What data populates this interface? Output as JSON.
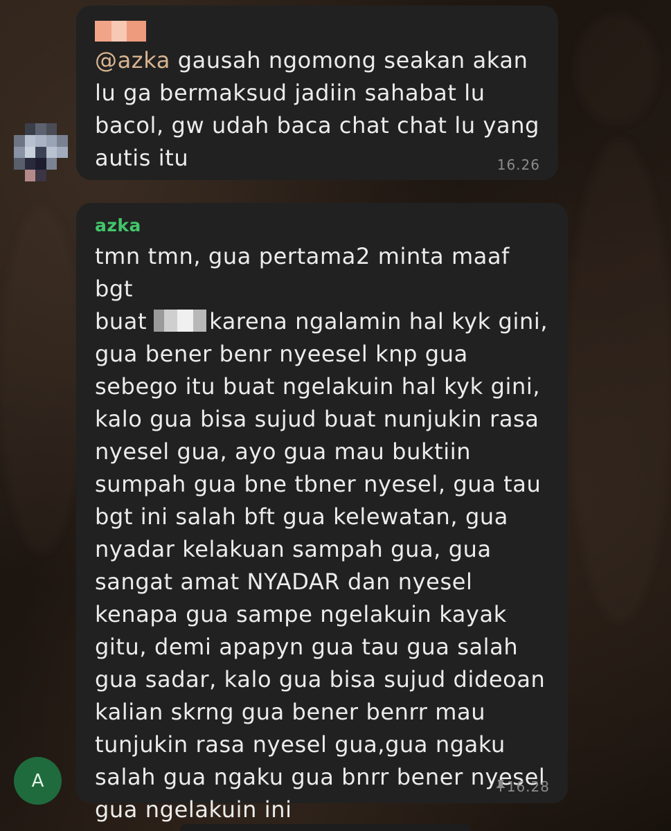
{
  "messages": [
    {
      "mention": "@azka",
      "text": " gausah ngomong seakan akan\nlu ga bermaksud jadiin sahabat lu\nbacol, gw udah baca chat chat lu yang\nautis itu",
      "time": "16.26"
    },
    {
      "sender": "azka",
      "text_line1": "tmn tmn, gua pertama2 minta maaf bgt\nbuat",
      "text_rest": "karena ngalamin hal kyk gini,\ngua bener benr nyeesel knp gua\nsebego itu buat ngelakuin hal kyk gini,\nkalo gua bisa sujud buat nunjukin rasa\nnyesel gua, ayo gua mau buktiin\nsumpah gua bne tbner nyesel, gua tau\nbgt ini salah bft gua kelewatan, gua\nnyadar kelakuan sampah gua, gua\nsangat amat NYADAR dan nyesel\nkenapa gua sampe ngelakuin kayak\ngitu, demi apapyn gua tau gua salah\ngua sadar, kalo gua bisa sujud dideoan\nkalian skrng gua bener benrr mau\ntunjukin rasa nyesel gua,gua ngaku\nsalah gua ngaku gua bnrr bener nyesel\ngua ngelakuin ini",
      "pin_icon": "pin-icon",
      "time": "16.28"
    }
  ],
  "avatar_letter": "A",
  "colors": {
    "bubble": "#212121",
    "sender_name": "#42c66b",
    "mention": "#d9b591",
    "avatar": "#1f6b3e"
  }
}
